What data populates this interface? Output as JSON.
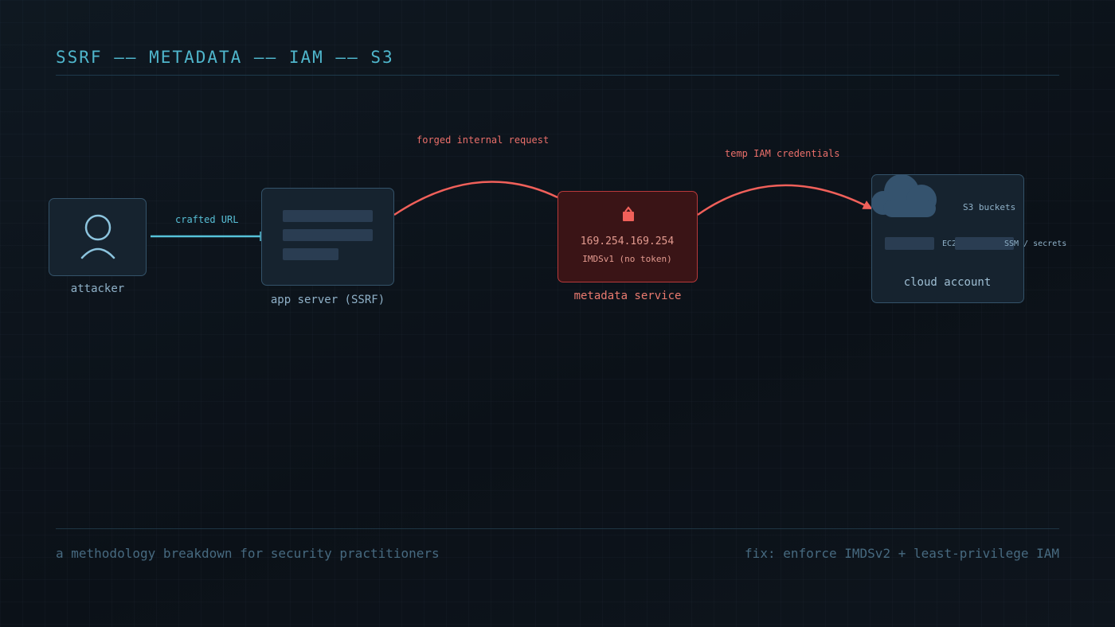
{
  "header": {
    "title": "SSRF —— METADATA —— IAM —— S3"
  },
  "nodes": {
    "attacker": {
      "caption": "attacker"
    },
    "app_server": {
      "caption": "app server (SSRF)"
    },
    "metadata": {
      "caption": "metadata service",
      "ip": "169.254.169.254",
      "version": "IMDSv1 (no token)"
    },
    "cloud": {
      "caption": "cloud account",
      "s3": "S3 buckets",
      "ec2": "EC2",
      "ssm": "SSM / secrets"
    }
  },
  "edges": {
    "crafted_url": "crafted URL",
    "forged_request": "forged internal request",
    "temp_credentials": "temp IAM credentials"
  },
  "footer": {
    "left": "a methodology breakdown for security practitioners",
    "right": "fix: enforce IMDSv2 + least-privilege IAM"
  },
  "colors": {
    "accent_cyan": "#4fb6cc",
    "danger_red": "#f0605a",
    "node_border": "#34536a"
  },
  "icons": [
    "user-icon",
    "lock-icon",
    "cloud-icon"
  ]
}
